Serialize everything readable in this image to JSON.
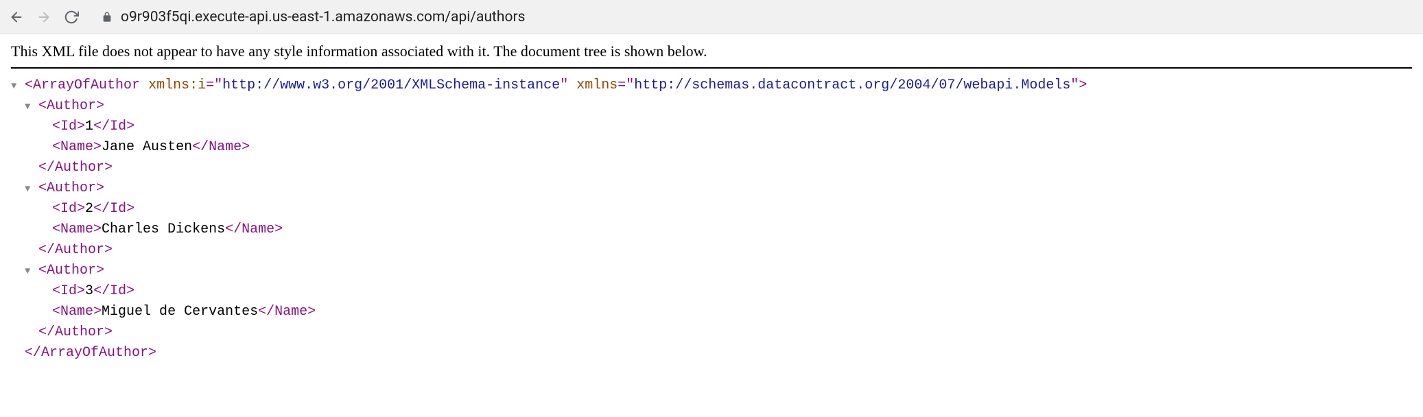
{
  "toolbar": {
    "url": "o9r903f5qi.execute-api.us-east-1.amazonaws.com/api/authors"
  },
  "notice": "This XML file does not appear to have any style information associated with it. The document tree is shown below.",
  "xml": {
    "root": {
      "name": "ArrayOfAuthor",
      "attrs": [
        {
          "name": "xmlns:i",
          "value": "http://www.w3.org/2001/XMLSchema-instance"
        },
        {
          "name": "xmlns",
          "value": "http://schemas.datacontract.org/2004/07/webapi.Models"
        }
      ]
    },
    "authors": [
      {
        "id": "1",
        "name": "Jane Austen"
      },
      {
        "id": "2",
        "name": "Charles Dickens"
      },
      {
        "id": "3",
        "name": "Miguel de Cervantes"
      }
    ],
    "tags": {
      "author": "Author",
      "id": "Id",
      "name": "Name"
    }
  },
  "toggle_glyph": "▼"
}
